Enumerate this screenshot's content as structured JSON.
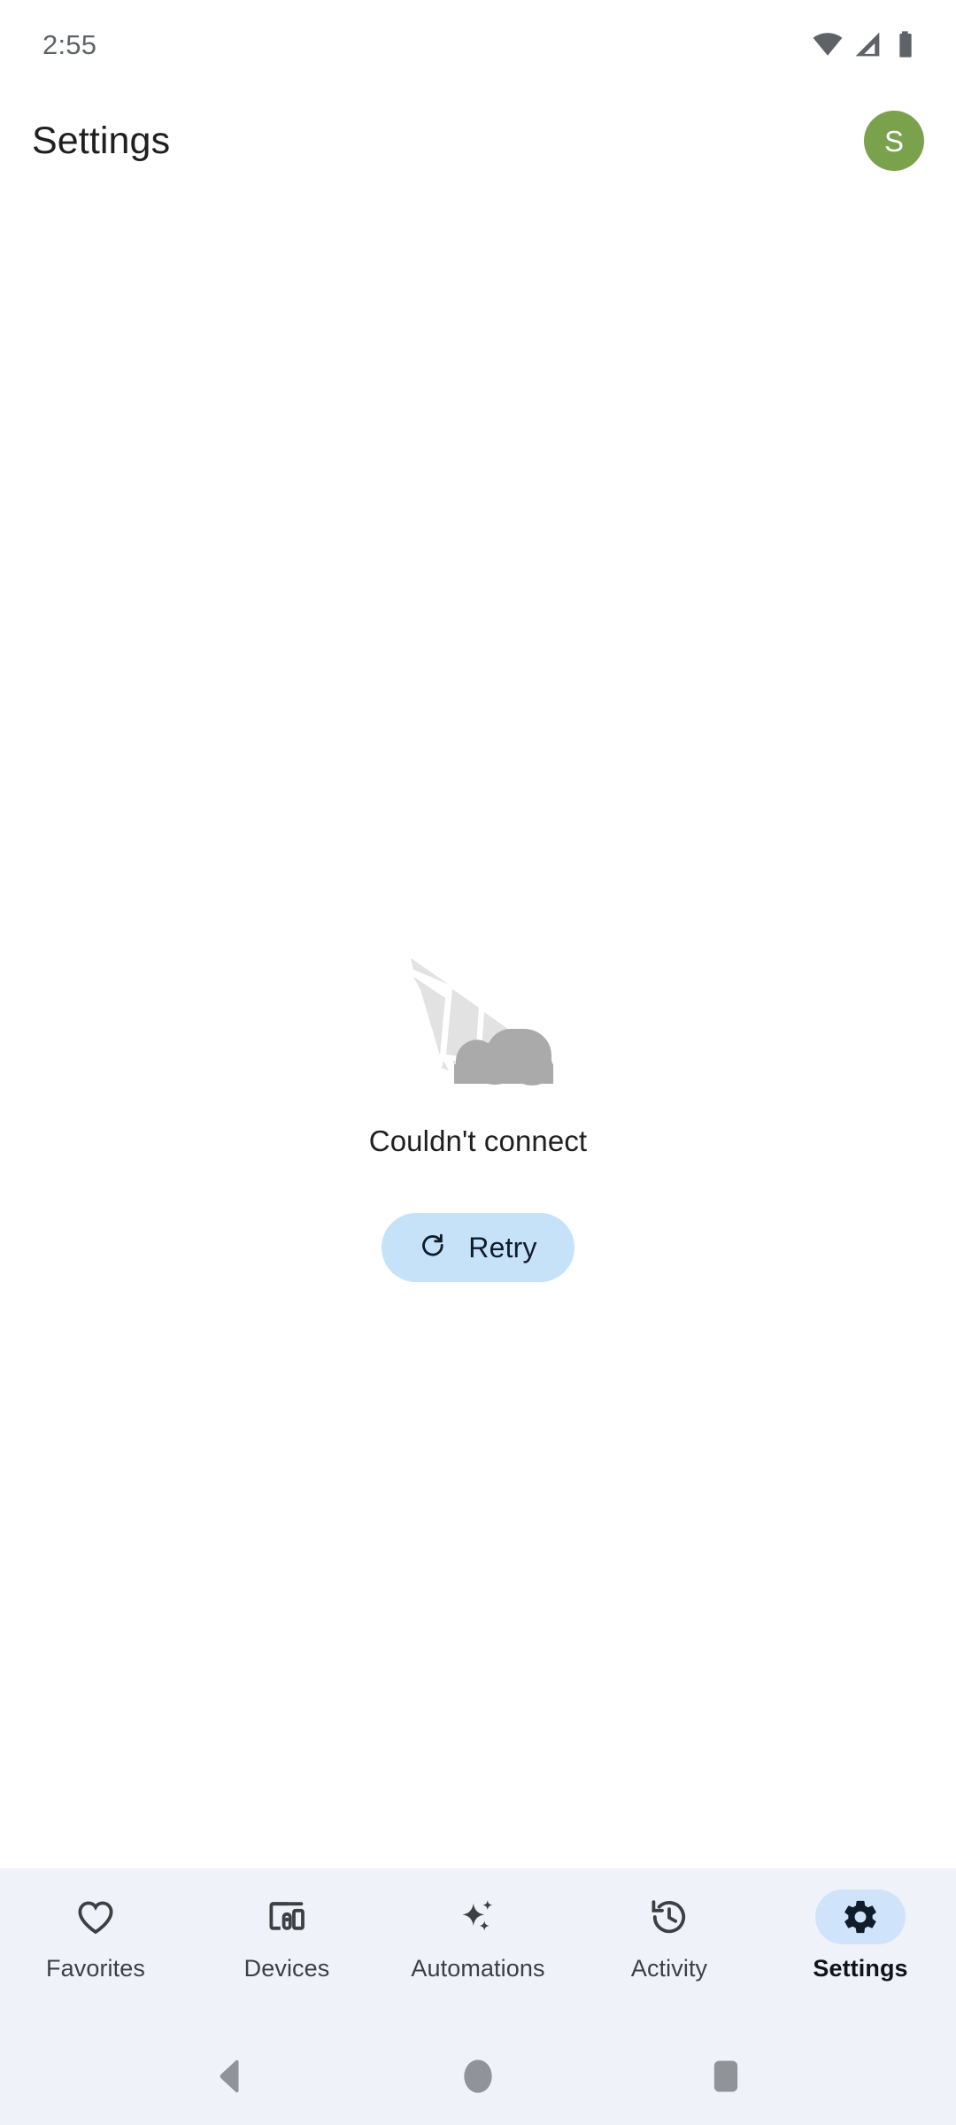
{
  "status_bar": {
    "time": "2:55",
    "icons": [
      "wifi-icon",
      "cellular-signal-icon",
      "battery-icon"
    ]
  },
  "header": {
    "title": "Settings",
    "avatar": {
      "initial": "S",
      "background_color": "#7aa24c",
      "text_color": "#ffffff",
      "name": "account-avatar"
    }
  },
  "main": {
    "illustration": {
      "name": "offline-cloud-illustration",
      "light_color": "#e2e2e2",
      "dark_color": "#aaaaaa"
    },
    "error_message": "Couldn't connect",
    "retry_button": {
      "label": "Retry",
      "icon": "refresh-icon",
      "background_color": "#c5e2f9",
      "text_color": "#111c2b"
    }
  },
  "tab_bar": {
    "background_color": "#eff3f9",
    "active_pill_color": "#cfe4fb",
    "items": [
      {
        "label": "Favorites",
        "icon": "heart-icon",
        "active": false
      },
      {
        "label": "Devices",
        "icon": "devices-icon",
        "active": false
      },
      {
        "label": "Automations",
        "icon": "sparkles-icon",
        "active": false
      },
      {
        "label": "Activity",
        "icon": "history-icon",
        "active": false
      },
      {
        "label": "Settings",
        "icon": "gear-icon",
        "active": true
      }
    ]
  },
  "system_nav": {
    "background_color": "#eff3f9",
    "icon_color": "#909499",
    "buttons": [
      {
        "name": "back-button",
        "icon": "triangle-back-icon"
      },
      {
        "name": "home-button",
        "icon": "circle-home-icon"
      },
      {
        "name": "recents-button",
        "icon": "square-recents-icon"
      }
    ]
  }
}
